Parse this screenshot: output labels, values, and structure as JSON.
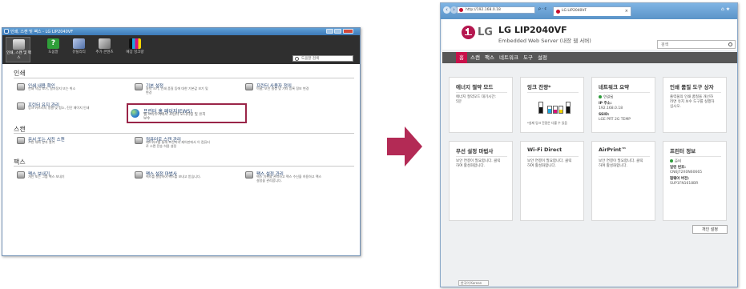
{
  "left_window": {
    "title": "인쇄, 스캔 및 팩스 - LG LIP2040VF",
    "ribbon": [
      {
        "label": "인쇄, 스캔 및 팩스",
        "icon": "printer-icon",
        "selected": true
      },
      {
        "label": "도움말",
        "icon": "help-icon"
      },
      {
        "label": "유틸리티",
        "icon": "utility-icon"
      },
      {
        "label": "추가 콘텐츠",
        "icon": "wrench-icon"
      },
      {
        "label": "예상 잉크량",
        "icon": "ink-level-icon"
      }
    ],
    "search_placeholder": "도움말 검색",
    "sections": [
      {
        "title": "인쇄",
        "items": [
          {
            "title": "인쇄 내용 확인",
            "desc": "인쇄 작업 보기, 일시정지 또는 취소",
            "icon": "print-queue-icon"
          },
          {
            "title": "기본 설정",
            "desc": "용지 크기, 인쇄 품질 등에 대한 기본값 보기 및\n변경",
            "icon": "preferences-icon"
          },
          {
            "title": "프린터 사용자 정의",
            "desc": "이름, 보안 설정 및 기타 등록 정보 변경",
            "icon": "customize-printer-icon"
          },
          {
            "title": "프린터 유지 관리",
            "desc": "잉크 카트리지 정렬 및 청소, 진단 페이지 인쇄",
            "icon": "maintenance-icon"
          },
          {
            "title": "프린터 홈 페이지(EWS)",
            "desc": "웹 브라우저에서 프린터 모니터링 및 유지\n보수",
            "icon": "globe-icon"
          }
        ]
      },
      {
        "title": "스캔",
        "items": [
          {
            "title": "문서 또는 사진 스캔",
            "desc": "스캔 대화 상자 열기",
            "icon": "scan-document-icon"
          },
          {
            "title": "컴퓨터로 스캔 관리",
            "desc": "네트워크를 통해 프린터의 제어판에서 이 컴퓨터\n로 스캔 전송 허용 설정",
            "icon": "scan-to-computer-icon"
          }
        ]
      },
      {
        "title": "팩스",
        "items": [
          {
            "title": "팩스 보내기",
            "desc": "개인 또는 그룹 팩스 보내기",
            "icon": "send-fax-icon"
          },
          {
            "title": "팩스 설정 마법사",
            "desc": "팩스를 설정하여 팩스를 보내고 받습니다.",
            "icon": "fax-wizard-icon"
          },
          {
            "title": "팩스 설정 관리",
            "desc": "팩스 기록을 관리하고 팩스 수신을 허용하고 팩스\n설정을 관리합니다.",
            "icon": "fax-settings-icon"
          }
        ]
      }
    ]
  },
  "browser": {
    "url": "http://192.168.0.18",
    "url_controls": "ρ - ¢",
    "tab_title": "LG LIP2040VF",
    "tools": "⌂ ★"
  },
  "ews": {
    "logo_text": "LG",
    "model": "LG LIP2040VF",
    "subtitle": "Embedded Web Server (내장 웹 서버)",
    "search_placeholder": "검색",
    "nav": [
      "홈",
      "스캔",
      "팩스",
      "네트워크",
      "도구",
      "설정"
    ],
    "cards": [
      {
        "title": "에너지 절약 모드",
        "lines": [
          {
            "text": "에너지 절약모드 대기시간:",
            "bold": false
          },
          {
            "text": "5분",
            "bold": false
          }
        ]
      },
      {
        "title": "잉크 잔량*",
        "lines": [
          {
            "text": "*실제 잉크 잔량은 다를 수 있음",
            "bold": false
          }
        ],
        "ink": [
          {
            "color": "#111111",
            "level": 0.55
          },
          {
            "color": "#1aa7e0",
            "level": 0.6
          },
          {
            "color": "#d8127a",
            "level": 0.55
          },
          {
            "color": "#f2d400",
            "level": 0.55
          },
          {
            "color": "#111111",
            "level": 0.6
          }
        ]
      },
      {
        "title": "네트워크 요약",
        "lines": [
          {
            "text": "연결됨",
            "bold": false,
            "dot": true
          },
          {
            "text": "IP 주소:",
            "bold": true
          },
          {
            "text": "192.168.0.18",
            "bold": false
          },
          {
            "text": "SSID:",
            "bold": true
          },
          {
            "text": "LGE PRT 2G TEMP",
            "bold": false
          }
        ]
      },
      {
        "title": "인쇄 품질 도구 상자",
        "lines": [
          {
            "text": "출력물의 인쇄 품질을 개선하",
            "bold": false
          },
          {
            "text": "려면 유지 보수 도구를 실행하",
            "bold": false
          },
          {
            "text": "십시오.",
            "bold": false
          }
        ]
      },
      {
        "title": "무선 설정 마법사",
        "lines": [
          {
            "text": "보안 연결이 필요합니다. 클릭",
            "bold": false
          },
          {
            "text": "하여 활성화합니다.",
            "bold": false
          }
        ]
      },
      {
        "title": "Wi-Fi Direct",
        "lines": [
          {
            "text": "보안 연결이 필요합니다. 클릭",
            "bold": false
          },
          {
            "text": "하여 활성화합니다.",
            "bold": false
          }
        ]
      },
      {
        "title": "AirPrint™",
        "lines": [
          {
            "text": "보안 연결이 필요합니다. 클릭",
            "bold": false
          },
          {
            "text": "하여 활성화합니다.",
            "bold": false
          }
        ]
      },
      {
        "title": "프린터 정보",
        "lines": [
          {
            "text": "준비",
            "bold": false,
            "dot": true
          },
          {
            "text": "일련 번호:",
            "bold": true
          },
          {
            "text": "CN6J72X0N60665",
            "bold": false
          },
          {
            "text": "펌웨어 버전:",
            "bold": true
          },
          {
            "text": "SUP1FN1618BR",
            "bold": false
          }
        ]
      }
    ],
    "settings_button": "개인 설정",
    "status_bar": "한국어 Korean"
  },
  "colors": {
    "lg_red": "#c8114a",
    "highlight_border": "#9a2548",
    "arrow": "#b32a55",
    "ribbon_bg": "#2f2f2f"
  }
}
